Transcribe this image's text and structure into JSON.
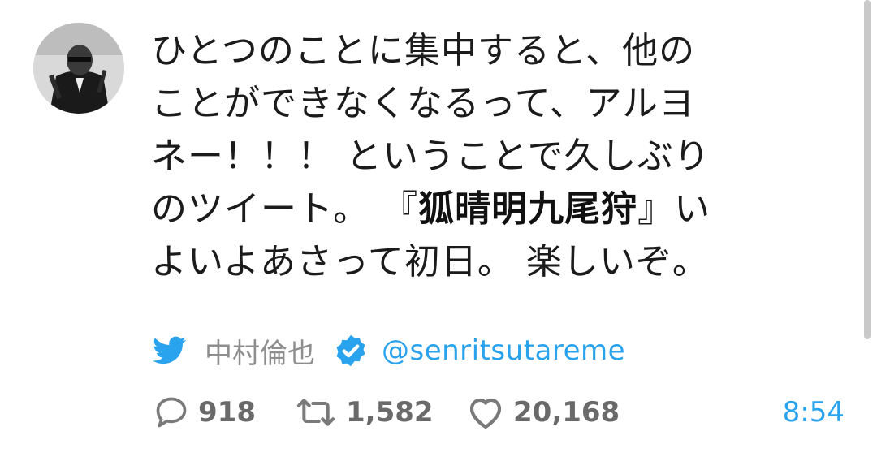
{
  "tweet": {
    "text_lines": [
      "ひとつのことに集中すると、他の",
      "ことができなくなるって、アルヨ",
      "ネー！！！ ということで久しぶり"
    ],
    "line4_prefix": "のツイート。 『",
    "line4_bold": "狐晴明九尾狩",
    "line4_suffix": "』い",
    "line5": "よいよあさって初日。 楽しいぞ。"
  },
  "author": {
    "name": "中村倫也",
    "handle": "@senritsutareme",
    "verified": true
  },
  "stats": {
    "replies": "918",
    "retweets": "1,582",
    "likes": "20,168"
  },
  "time": "8:54",
  "icons": {
    "source": "twitter-bird-icon",
    "verified": "verified-badge-icon",
    "reply": "reply-icon",
    "retweet": "retweet-icon",
    "like": "heart-icon"
  },
  "colors": {
    "accent": "#2aa3ef",
    "text": "#1b1b1b",
    "muted": "#8e8e8e",
    "counts": "#6a6a6a"
  }
}
